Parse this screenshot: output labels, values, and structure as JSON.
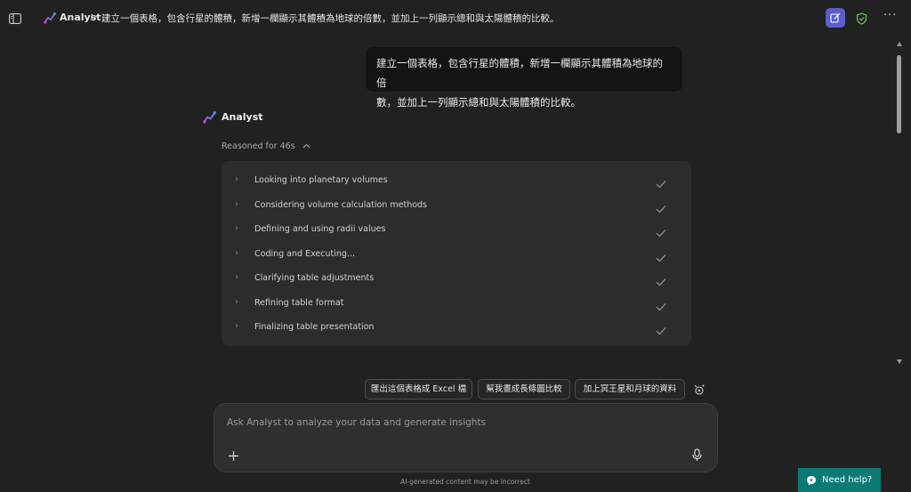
{
  "header": {
    "agent_name": "Analyst",
    "breadcrumb_separator": ">",
    "conversation_title": "建立一個表格，包含行星的體積，新增一欄顯示其體積為地球的倍數，並加上一列顯示總和與太陽體積的比較。"
  },
  "user_message": {
    "line1": "建立一個表格，包含行星的體積，新增一欄顯示其體積為地球的倍",
    "line2": "數，並加上一列顯示總和與太陽體積的比較。"
  },
  "agent": {
    "name": "Analyst"
  },
  "reasoning": {
    "summary": "Reasoned for 46s",
    "steps": [
      {
        "label": "Looking into planetary volumes"
      },
      {
        "label": "Considering volume calculation methods"
      },
      {
        "label": "Defining and using radii values"
      },
      {
        "label": "Coding and Executing..."
      },
      {
        "label": "Clarifying table adjustments"
      },
      {
        "label": "Refining table format"
      },
      {
        "label": "Finalizing table presentation"
      }
    ]
  },
  "suggestions": [
    {
      "label": "匯出這個表格成 Excel 檔"
    },
    {
      "label": "幫我畫成長條圖比較"
    },
    {
      "label": "加上冥王星和月球的資料"
    }
  ],
  "composer": {
    "placeholder": "Ask Analyst to analyze your data and generate insights"
  },
  "footer": {
    "disclaimer": "AI-generated content may be incorrect",
    "help_label": "Need help?"
  },
  "colors": {
    "background": "#212121",
    "accent": "#5b5fc7",
    "help": "#0b7a75",
    "shield": "#6ccb5f"
  }
}
